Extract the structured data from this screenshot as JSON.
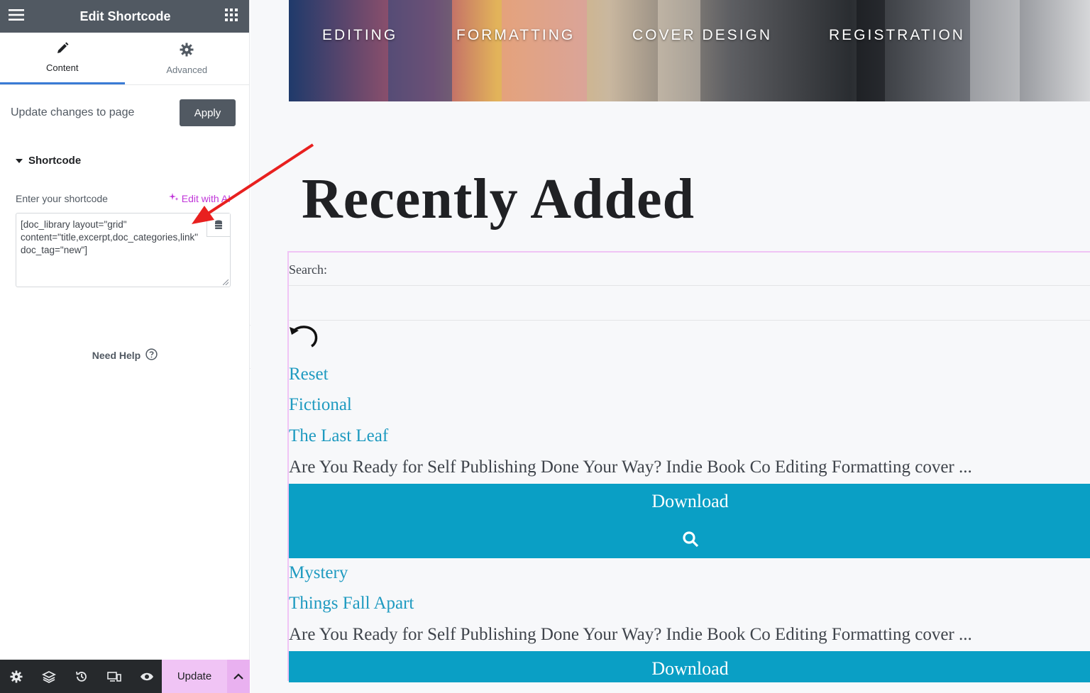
{
  "sidebar": {
    "title": "Edit Shortcode",
    "tabs": [
      {
        "label": "Content",
        "icon": "pencil-icon"
      },
      {
        "label": "Advanced",
        "icon": "gear-icon"
      }
    ],
    "update_changes_label": "Update changes to page",
    "apply_label": "Apply",
    "section_title": "Shortcode",
    "field_label": "Enter your shortcode",
    "ai_label": "Edit with AI",
    "shortcode_value": "[doc_library layout=\"grid\" content=\"title,excerpt,doc_categories,link\" doc_tag=\"new\"]",
    "need_help": "Need Help",
    "update_label": "Update"
  },
  "preview": {
    "nav": [
      "EDITING",
      "FORMATTING",
      "COVER DESIGN",
      "REGISTRATION"
    ],
    "heading": "Recently Added",
    "search_label": "Search:",
    "reset_label": "Reset",
    "items": [
      {
        "category": "Fictional",
        "title": "The Last Leaf",
        "excerpt": "Are You Ready for Self Publishing Done Your Way? Indie Book Co Editing Formatting cover ...",
        "download_label": "Download"
      },
      {
        "category": "Mystery",
        "title": "Things Fall Apart",
        "excerpt": "Are You Ready for Self Publishing Done Your Way? Indie Book Co Editing Formatting cover ...",
        "download_label": "Download"
      }
    ]
  },
  "colors": {
    "accent_link": "#1e9ac0",
    "download_bg": "#0a9fc5",
    "update_bg": "#f0c4f5",
    "header_bg": "#515962",
    "arrow": "#e8201f"
  }
}
